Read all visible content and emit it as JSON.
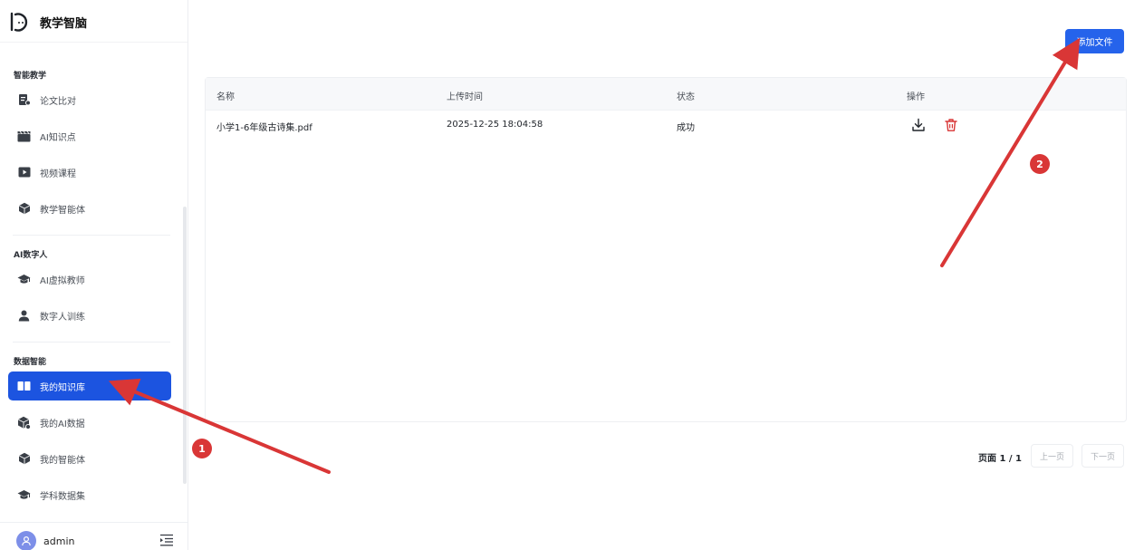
{
  "app": {
    "name": "教学智脑"
  },
  "sidebar": {
    "sections": [
      {
        "title": "智能教学",
        "items": [
          {
            "label": "论文比对",
            "icon": "compare-doc-icon"
          },
          {
            "label": "AI知识点",
            "icon": "clapperboard-icon"
          },
          {
            "label": "视频课程",
            "icon": "play-icon"
          },
          {
            "label": "教学智能体",
            "icon": "cube-icon"
          }
        ]
      },
      {
        "title": "AI数字人",
        "items": [
          {
            "label": "AI虚拟教师",
            "icon": "graduation-cap-icon"
          },
          {
            "label": "数字人训练",
            "icon": "person-icon"
          }
        ]
      },
      {
        "title": "数据智能",
        "items": [
          {
            "label": "我的知识库",
            "icon": "book-open-icon",
            "active": true
          },
          {
            "label": "我的AI数据",
            "icon": "data-box-icon"
          },
          {
            "label": "我的智能体",
            "icon": "cube-icon"
          },
          {
            "label": "学科数据集",
            "icon": "graduation-cap-icon"
          }
        ]
      }
    ],
    "user": {
      "name": "admin"
    }
  },
  "toolbar": {
    "add_file_label": "添加文件"
  },
  "table": {
    "columns": [
      "名称",
      "上传时间",
      "状态",
      "操作"
    ],
    "rows": [
      {
        "name": "小学1-6年级古诗集.pdf",
        "uploaded": "2025-12-25 18:04:58",
        "status": "成功"
      }
    ]
  },
  "pagination": {
    "text": "页面 1 / 1",
    "prev": "上一页",
    "next": "下一页"
  },
  "annotations": {
    "badge1": "1",
    "badge2": "2"
  },
  "colors": {
    "accent": "#1c54e0",
    "button": "#2563eb",
    "annotation": "#d93636",
    "delete": "#d93636"
  }
}
